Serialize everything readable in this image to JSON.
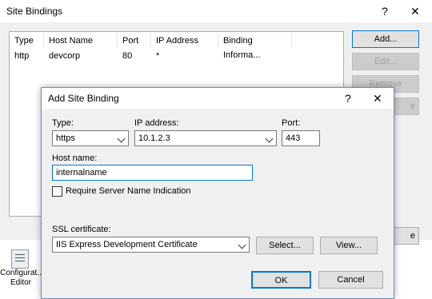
{
  "site_bindings": {
    "title": "Site Bindings",
    "help_glyph": "?",
    "close_glyph": "✕",
    "columns": [
      "Type",
      "Host Name",
      "Port",
      "IP Address",
      "Binding Informa..."
    ],
    "rows": [
      {
        "type": "http",
        "host": "devcorp",
        "port": "80",
        "ip": "*",
        "info": ""
      }
    ],
    "buttons": {
      "add": "Add...",
      "edit": "Edit...",
      "remove": "Remove",
      "browse": "e",
      "close": "e"
    }
  },
  "desktop": {
    "icon_label": "Configurat.. Editor",
    "icon_name": "config-editor-icon"
  },
  "add_site_binding": {
    "title": "Add Site Binding",
    "help_glyph": "?",
    "close_glyph": "✕",
    "type_label": "Type:",
    "type_value": "https",
    "ip_label": "IP address:",
    "ip_value": "10.1.2.3",
    "port_label": "Port:",
    "port_value": "443",
    "host_label": "Host name:",
    "host_value": "internalname",
    "sni_label": "Require Server Name Indication",
    "sni_checked": false,
    "ssl_label": "SSL certificate:",
    "ssl_value": "IIS Express Development Certificate",
    "select_button": "Select...",
    "view_button": "View...",
    "ok_button": "OK",
    "cancel_button": "Cancel"
  },
  "colors": {
    "window_bg": "#f0f0f0",
    "focus_border": "#0078d7",
    "dialog_border": "#6e8fb7"
  }
}
